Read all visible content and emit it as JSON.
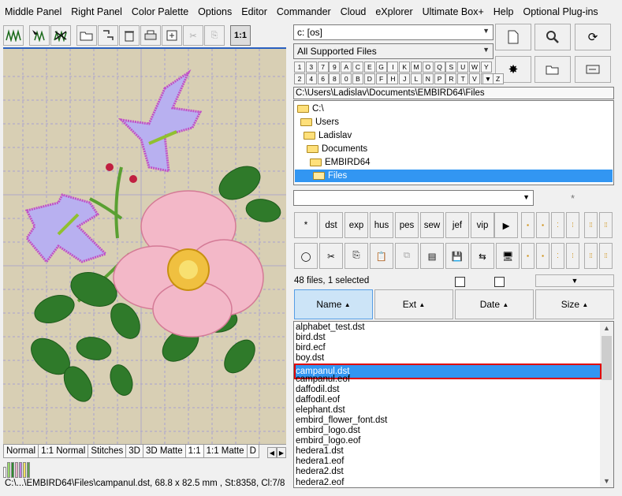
{
  "menu": [
    "Middle Panel",
    "Right Panel",
    "Color Palette",
    "Options",
    "Editor",
    "Commander",
    "Cloud",
    "eXplorer",
    "Ultimate Box+",
    "Help",
    "Optional Plug-ins"
  ],
  "left_toolbar": {
    "buttons": [
      "stitch-icon",
      "pointer-stitch-icon",
      "cross-stitch-icon",
      "open-folder-icon",
      "move-icon",
      "delete-icon",
      "print-icon",
      "export-icon",
      "scissors-icon",
      "copy-icon"
    ],
    "zoom_label": "1:1"
  },
  "bottom_tabs": [
    "Normal",
    "1:1 Normal",
    "Stitches",
    "3D",
    "3D Matte",
    "1:1",
    "1:1 Matte",
    "D"
  ],
  "swatches": [
    "#ffffff",
    "#9ad86a",
    "#2e8b2e",
    "#e8b0c8",
    "#c080e0",
    "#f4e060",
    "#60a050"
  ],
  "status_text": "C:\\...\\EMBIRD64\\Files\\campanul.dst, 68.8 x 82.5 mm , St:8358, Cl:7/8",
  "right": {
    "drive_select": "c: [os]",
    "type_select": "All Supported Files",
    "drive_row1": [
      "1",
      "3",
      "7",
      "9",
      "A",
      "C",
      "E",
      "G",
      "I",
      "K",
      "M",
      "O",
      "Q",
      "S",
      "U",
      "W",
      "Y"
    ],
    "drive_row2": [
      "2",
      "4",
      "6",
      "8",
      "0",
      "B",
      "D",
      "F",
      "H",
      "J",
      "L",
      "N",
      "P",
      "R",
      "T",
      "V",
      "X",
      "Z"
    ],
    "path": "C:\\Users\\Ladislav\\Documents\\EMBIRD64\\Files",
    "tree": [
      "C:\\",
      "Users",
      "Ladislav",
      "Documents",
      "EMBIRD64",
      "Files"
    ],
    "filter_star": "*",
    "filter_buttons": [
      "*",
      "dst",
      "exp",
      "hus",
      "pes",
      "sew",
      "jef",
      "vip"
    ],
    "file_count": "48 files, 1 selected",
    "headers": [
      "Name",
      "Ext",
      "Date",
      "Size"
    ],
    "files": [
      "alphabet_test.dst",
      "bird.dst",
      "bird.ecf",
      "boy.dst",
      "campanul.dst",
      "campanul.eof",
      "daffodil.dst",
      "daffodil.eof",
      "elephant.dst",
      "embird_flower_font.dst",
      "embird_logo.dst",
      "embird_logo.eof",
      "hedera1.dst",
      "hedera1.eof",
      "hedera2.dst",
      "hedera2.eof"
    ],
    "selected_file": "campanul.dst"
  }
}
